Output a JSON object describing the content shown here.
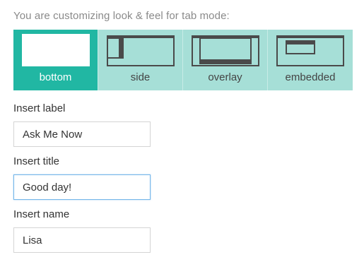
{
  "intro_text": "You are customizing look & feel for tab mode:",
  "modes": [
    {
      "label": "bottom",
      "icon": "bottom-mode-icon",
      "active": true
    },
    {
      "label": "side",
      "icon": "side-mode-icon",
      "active": false
    },
    {
      "label": "overlay",
      "icon": "overlay-mode-icon",
      "active": false
    },
    {
      "label": "embedded",
      "icon": "embedded-mode-icon",
      "active": false
    }
  ],
  "fields": {
    "label": {
      "title": "Insert label",
      "value": "Ask Me Now"
    },
    "title": {
      "title": "Insert title",
      "value": "Good day!"
    },
    "name": {
      "title": "Insert name",
      "value": "Lisa"
    }
  },
  "colors": {
    "active_tab": "#21b7a3",
    "inactive_tab": "#a6dfd7",
    "focus_border": "#74b6ea"
  }
}
